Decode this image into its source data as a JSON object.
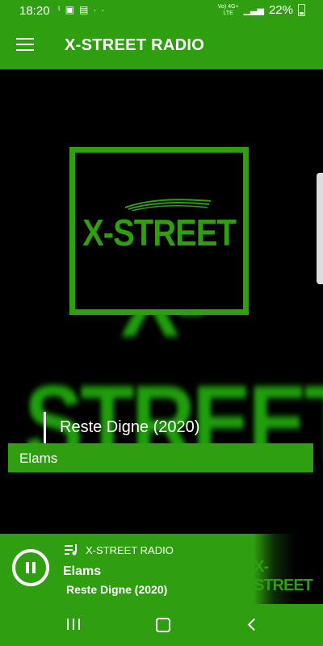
{
  "status_bar": {
    "time": "18:20",
    "left_icons": [
      "notification-icon",
      "image-icon",
      "calendar-icon",
      "more-dots-icon"
    ],
    "network_top": "Vo) 4G+",
    "network_bottom": "LTE",
    "battery_percent": "22%"
  },
  "app_bar": {
    "title": "X-STREET RADIO",
    "menu_icon": "hamburger-menu-icon"
  },
  "main": {
    "cover_logo_text": "X-STREET",
    "background_logo_text": "X-STREET",
    "track_title": "Reste Digne (2020)",
    "artist": "Elams"
  },
  "player": {
    "station": "X-STREET RADIO",
    "artist": "Elams",
    "song": "Reste Digne (2020)",
    "thumbnail_text": "X-STREET",
    "state": "playing"
  },
  "colors": {
    "brand_green": "#2f9e10",
    "background": "#000000",
    "text": "#ffffff"
  }
}
